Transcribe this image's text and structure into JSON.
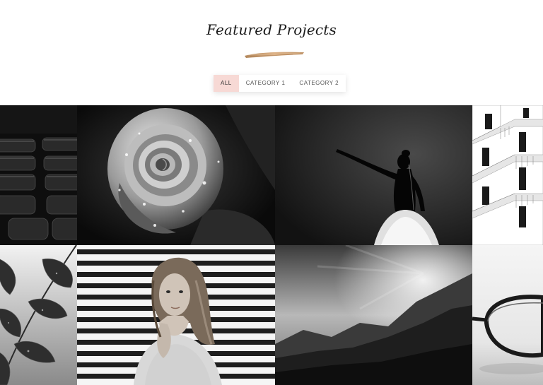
{
  "header": {
    "title": "Featured Projects"
  },
  "filters": [
    {
      "label": "ALL",
      "active": true
    },
    {
      "label": "CATEGORY 1",
      "active": false
    },
    {
      "label": "CATEGORY 2",
      "active": false
    }
  ],
  "colors": {
    "accent": "#f7d9d5",
    "brush": "#c8966a",
    "text": "#1b1b1b"
  },
  "gallery": {
    "items": [
      {
        "subject": "theater-seats"
      },
      {
        "subject": "rose"
      },
      {
        "subject": "dancer"
      },
      {
        "subject": "building"
      },
      {
        "subject": "leaves"
      },
      {
        "subject": "woman-portrait"
      },
      {
        "subject": "mountains"
      },
      {
        "subject": "eyeglasses"
      }
    ]
  }
}
